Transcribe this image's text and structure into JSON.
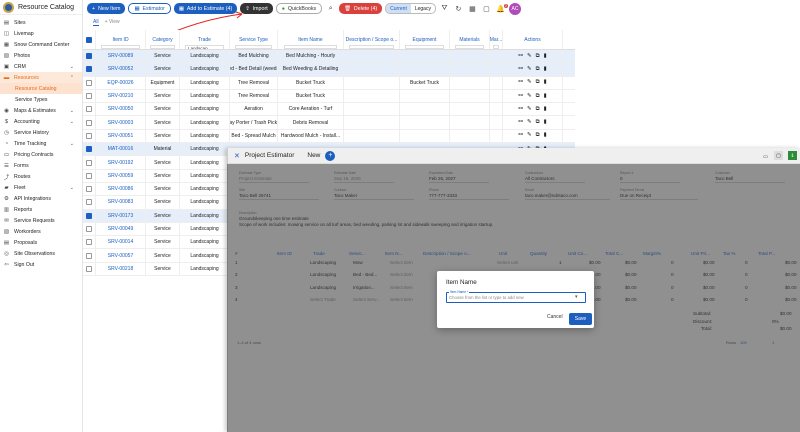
{
  "brand": {
    "name": "Resource Catalog"
  },
  "sidebar": {
    "items": [
      {
        "label": "Sites",
        "icon": "building-icon",
        "glyph": "▤"
      },
      {
        "label": "Livemap",
        "icon": "map-icon",
        "glyph": "◫"
      },
      {
        "label": "Snow Command Center",
        "icon": "grid-icon",
        "glyph": "▦"
      },
      {
        "label": "Photos",
        "icon": "photo-icon",
        "glyph": "▨"
      },
      {
        "label": "CRM",
        "icon": "crm-icon",
        "glyph": "▣",
        "chev": "⌄"
      },
      {
        "label": "Resources",
        "icon": "briefcase-icon",
        "glyph": "▬",
        "chev": "⌃",
        "active": true
      },
      {
        "label": "Resource Catalog",
        "sub": true,
        "active": true
      },
      {
        "label": "Service Types",
        "sub": true
      },
      {
        "label": "Maps & Estimates",
        "icon": "pin-icon",
        "glyph": "◉",
        "chev": "⌄"
      },
      {
        "label": "Accounting",
        "icon": "dollar-icon",
        "glyph": "$",
        "chev": "⌄"
      },
      {
        "label": "Service History",
        "icon": "history-icon",
        "glyph": "◷"
      },
      {
        "label": "Time Tracking",
        "icon": "clock-icon",
        "glyph": "◔",
        "chev": "⌄"
      },
      {
        "label": "Pricing Contracts",
        "icon": "contract-icon",
        "glyph": "▭"
      },
      {
        "label": "Forms",
        "icon": "form-icon",
        "glyph": "☰"
      },
      {
        "label": "Routes",
        "icon": "route-icon",
        "glyph": "⤴"
      },
      {
        "label": "Fleet",
        "icon": "truck-icon",
        "glyph": "▰",
        "chev": "⌄"
      },
      {
        "label": "API Integrations",
        "icon": "api-icon",
        "glyph": "⚙"
      },
      {
        "label": "Reports",
        "icon": "chart-icon",
        "glyph": "▥"
      },
      {
        "label": "Service Requests",
        "icon": "request-icon",
        "glyph": "✉"
      },
      {
        "label": "Workorders",
        "icon": "workorder-icon",
        "glyph": "▧"
      },
      {
        "label": "Proposals",
        "icon": "proposal-icon",
        "glyph": "▤"
      },
      {
        "label": "Site Observations",
        "icon": "eye-icon",
        "glyph": "◎"
      },
      {
        "label": "Sign Out",
        "icon": "signout-icon",
        "glyph": "⇦"
      }
    ]
  },
  "toolbar": {
    "new_item": "New Item",
    "estimator": "Estimator",
    "add_to_estimate": "Add to Estimate (4)",
    "import": "Import",
    "quickbooks": "QuickBooks",
    "delete": "Delete (4)",
    "current": "Current",
    "legacy": "Legacy",
    "notif_count": "2",
    "avatar": "AC"
  },
  "tabs": {
    "all": "All",
    "add_view": "+ View"
  },
  "grid": {
    "columns": [
      "Item ID",
      "Category",
      "Trade",
      "Service Type",
      "Item Name",
      "Description / Scope o...",
      "Equipment",
      "Materials",
      "Mar...",
      "Actions"
    ],
    "trade_filter": "Landscap...",
    "rows": [
      {
        "id": "SRV-00089",
        "cat": "Service",
        "trade": "Landscaping",
        "stype": "Bed Mulching",
        "name": "Bed Mulching - Hourly",
        "equip": "",
        "sel": true
      },
      {
        "id": "SRV-00052",
        "cat": "Service",
        "trade": "Landscaping",
        "stype": "Bed - Bed Detail (weedi...",
        "name": "Bed Weeding & Detailing",
        "equip": "",
        "sel": true
      },
      {
        "id": "EQP-00026",
        "cat": "Equipment",
        "trade": "Landscaping",
        "stype": "Tree Removal",
        "name": "Bucket Truck",
        "equip": "Bucket Truck",
        "sel": false
      },
      {
        "id": "SRV-00210",
        "cat": "Service",
        "trade": "Landscaping",
        "stype": "Tree Removal",
        "name": "Bucket Truck",
        "equip": "",
        "sel": false
      },
      {
        "id": "SRV-00050",
        "cat": "Service",
        "trade": "Landscaping",
        "stype": "Aeration",
        "name": "Core Aeration - Turf",
        "equip": "",
        "sel": false
      },
      {
        "id": "SRV-00003",
        "cat": "Service",
        "trade": "Landscaping",
        "stype": "Day Porter / Trash Pick...",
        "name": "Debris Removal",
        "equip": "",
        "sel": false
      },
      {
        "id": "SRV-00051",
        "cat": "Service",
        "trade": "Landscaping",
        "stype": "Bed - Spread Mulch",
        "name": "Hardwood Mulch - Install...",
        "equip": "",
        "sel": false
      },
      {
        "id": "MAT-00016",
        "cat": "Material",
        "trade": "Landscaping",
        "stype": "",
        "name": "",
        "equip": "",
        "sel": true
      },
      {
        "id": "SRV-00192",
        "cat": "Service",
        "trade": "Landscaping",
        "stype": "",
        "name": "",
        "equip": "",
        "sel": false
      },
      {
        "id": "SRV-00059",
        "cat": "Service",
        "trade": "Landscaping",
        "stype": "",
        "name": "",
        "equip": "",
        "sel": false
      },
      {
        "id": "SRV-00086",
        "cat": "Service",
        "trade": "Landscaping",
        "stype": "",
        "name": "",
        "equip": "",
        "sel": false
      },
      {
        "id": "SRV-00083",
        "cat": "Service",
        "trade": "Landscaping",
        "stype": "",
        "name": "",
        "equip": "",
        "sel": false
      },
      {
        "id": "SRV-00173",
        "cat": "Service",
        "trade": "Landscaping",
        "stype": "",
        "name": "",
        "equip": "",
        "sel": true
      },
      {
        "id": "SRV-00049",
        "cat": "Service",
        "trade": "Landscaping",
        "stype": "",
        "name": "",
        "equip": "",
        "sel": false
      },
      {
        "id": "SRV-00014",
        "cat": "Service",
        "trade": "Landscaping",
        "stype": "",
        "name": "",
        "equip": "",
        "sel": false
      },
      {
        "id": "SRV-00057",
        "cat": "Service",
        "trade": "Landscaping",
        "stype": "",
        "name": "",
        "equip": "",
        "sel": false
      },
      {
        "id": "SRV-00218",
        "cat": "Service",
        "trade": "Landscaping",
        "stype": "",
        "name": "",
        "equip": "",
        "sel": false
      }
    ]
  },
  "estimator": {
    "title": "Project Estimator",
    "tab_new": "New",
    "fields": {
      "estimate_type": {
        "label": "Estimate Type",
        "value": "Project Estimate"
      },
      "estimate_date": {
        "label": "Estimate Date",
        "value": "Sep 18, 2025"
      },
      "expiration_date": {
        "label": "Expiration Date",
        "value": "Feb 26, 2027"
      },
      "contractors": {
        "label": "Contractors",
        "value": "All Contractors"
      },
      "report": {
        "label": "Report #",
        "value": "0"
      },
      "customer": {
        "label": "Customer",
        "value": "Taco Bell"
      },
      "site": {
        "label": "Site",
        "value": "Taco Bell 26741"
      },
      "contact": {
        "label": "Contact",
        "value": "Taco Maker"
      },
      "phone": {
        "label": "Phone",
        "value": "777-777-3333"
      },
      "email": {
        "label": "Email",
        "value": "taco.maker@ndntaco.com"
      },
      "payment_terms": {
        "label": "Payment Terms",
        "value": "Due on Receipt"
      }
    },
    "description_label": "Description",
    "description_lines": [
      "Groundskeeping one time estimate",
      "Scope of work includes: mowing service on all turf areas, bed weeding, parking lot and sidewalk sweeping and irrigation startup."
    ],
    "line_cols": [
      "#",
      "Item ID",
      "Trade",
      "Servic...",
      "Item N...",
      "Description / Scope o...",
      "Unit",
      "Quantity",
      "Unit Co...",
      "Total C...",
      "Margin%",
      "Unit Pri...",
      "Tax %",
      "Total P..."
    ],
    "lines": [
      {
        "n": "1",
        "trade": "Landscaping",
        "svc": "Mow",
        "item": "Select item",
        "unit": "Select unit",
        "qty": "1",
        "ucost": "$0.00",
        "tcost": "$0.00",
        "margin": "0",
        "uprice": "$0.00",
        "tax": "0",
        "tprice": "$0.00"
      },
      {
        "n": "2",
        "trade": "Landscaping",
        "svc": "Bed - Bed...",
        "item": "Select item",
        "unit": "",
        "qty": "1",
        "ucost": "$0.00",
        "tcost": "$0.00",
        "margin": "0",
        "uprice": "$0.00",
        "tax": "0",
        "tprice": "$0.00"
      },
      {
        "n": "3",
        "trade": "Landscaping",
        "svc": "Irrigation...",
        "item": "Select item",
        "unit": "",
        "qty": "1",
        "ucost": "$0.00",
        "tcost": "$0.00",
        "margin": "0",
        "uprice": "$0.00",
        "tax": "0",
        "tprice": "$0.00"
      },
      {
        "n": "4",
        "trade": "Select Trade",
        "svc": "Select Serv...",
        "item": "Select item",
        "unit": "",
        "qty": "1",
        "ucost": "$0.00",
        "tcost": "$0.00",
        "margin": "0",
        "uprice": "$0.00",
        "tax": "0",
        "tprice": "$0.00"
      }
    ],
    "totals": {
      "subtotal_label": "Subtotal:",
      "subtotal": "$0.00",
      "discount_label": "Discount:",
      "discount": "0%",
      "total_label": "Total:",
      "total": "$0.00"
    },
    "pager": {
      "range": "1–4 of 4 rows",
      "rows_label": "Rows",
      "rows": "100",
      "page": "1"
    }
  },
  "modal": {
    "title": "Item Name",
    "field_label": "Item Name *",
    "placeholder": "Choose from the list or type to add new",
    "cancel": "Cancel",
    "save": "Save"
  }
}
